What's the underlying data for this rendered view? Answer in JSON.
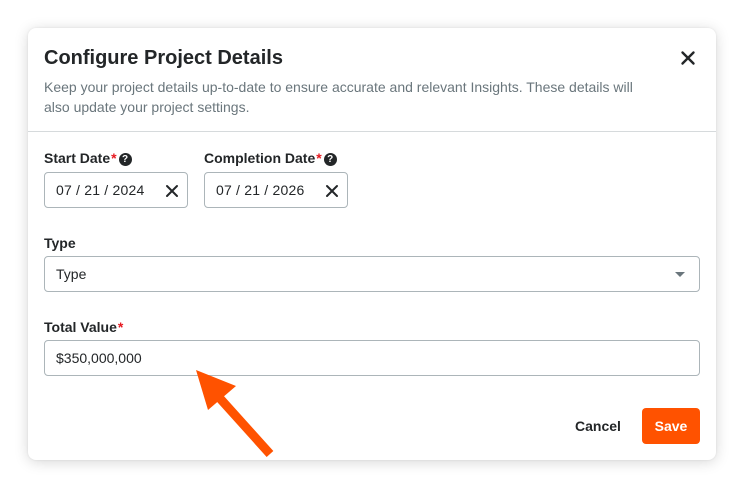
{
  "colors": {
    "accent": "#ff5200",
    "required": "#e61920",
    "arrow": "#ff5200"
  },
  "dialog": {
    "title": "Configure Project Details",
    "description": "Keep your project details up-to-date to ensure accurate and relevant Insights. These details will also update your project settings.",
    "close_icon": "close-icon"
  },
  "start_date": {
    "label": "Start Date",
    "required_mark": "*",
    "help_icon": "?",
    "value": "07 / 21 / 2024",
    "clear_icon": "close-icon"
  },
  "completion_date": {
    "label": "Completion Date",
    "required_mark": "*",
    "help_icon": "?",
    "value": "07 / 21 / 2026",
    "clear_icon": "close-icon"
  },
  "type": {
    "label": "Type",
    "selected": "Type",
    "dropdown_icon": "caret-down-icon"
  },
  "total_value": {
    "label": "Total Value",
    "required_mark": "*",
    "value": "$350,000,000"
  },
  "footer": {
    "cancel_label": "Cancel",
    "save_label": "Save"
  },
  "annotation": {
    "icon": "arrow-icon"
  }
}
